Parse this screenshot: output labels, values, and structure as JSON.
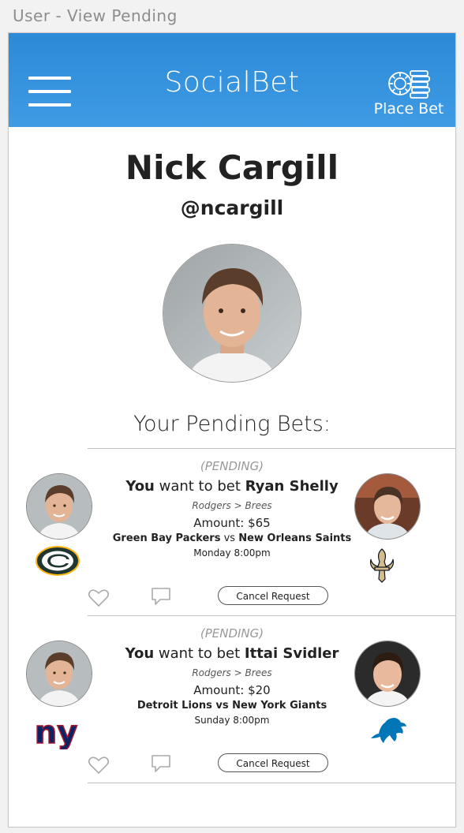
{
  "window": {
    "title": "User - View Pending"
  },
  "header": {
    "app_name": "SocialBet",
    "place_bet_label": "Place Bet"
  },
  "profile": {
    "name": "Nick Cargill",
    "handle": "@ncargill"
  },
  "pending": {
    "section_title": "Your Pending Bets:",
    "bets": [
      {
        "status": "(PENDING)",
        "prefix": "You",
        "middle": " want to bet ",
        "opponent": "Ryan Shelly",
        "pick": "Rodgers > Brees",
        "amount": "Amount: $65",
        "home_team": "Green Bay Packers",
        "vs": " vs ",
        "away_team": "New Orleans Saints",
        "time": "Monday 8:00pm",
        "cancel_label": "Cancel Request",
        "user_team_logo": "packers-logo",
        "opponent_team_logo": "saints-logo"
      },
      {
        "status": "(PENDING)",
        "prefix": "You",
        "middle": " want to bet ",
        "opponent": "Ittai Svidler",
        "pick": "Rodgers > Brees",
        "amount": "Amount: $20",
        "home_team": "Detroit Lions",
        "vs": " vs ",
        "away_team": "New York Giants",
        "time": "Sunday 8:00pm",
        "cancel_label": "Cancel Request",
        "user_team_logo": "giants-logo",
        "opponent_team_logo": "lions-logo"
      }
    ]
  },
  "colors": {
    "header": "#3591dd",
    "text": "#222222",
    "muted": "#999999"
  }
}
